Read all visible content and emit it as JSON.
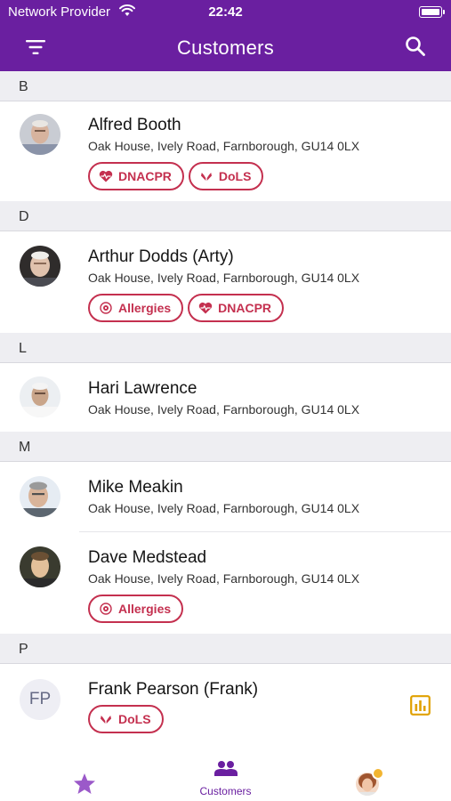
{
  "status_bar": {
    "carrier": "Network Provider",
    "time": "22:42"
  },
  "header": {
    "title": "Customers",
    "filter_icon": "filter-icon",
    "search_icon": "search-icon"
  },
  "sections": [
    {
      "letter": "B",
      "customers": [
        {
          "name": "Alfred Booth",
          "address": "Oak House, Ively Road, Farnborough, GU14 0LX",
          "tags": [
            "DNACPR",
            "DoLS"
          ]
        }
      ]
    },
    {
      "letter": "D",
      "customers": [
        {
          "name": "Arthur Dodds (Arty)",
          "address": "Oak House, Ively Road, Farnborough, GU14 0LX",
          "tags": [
            "Allergies",
            "DNACPR"
          ]
        }
      ]
    },
    {
      "letter": "L",
      "customers": [
        {
          "name": "Hari Lawrence",
          "address": "Oak House, Ively Road, Farnborough, GU14 0LX",
          "tags": []
        }
      ]
    },
    {
      "letter": "M",
      "customers": [
        {
          "name": "Mike Meakin",
          "address": "Oak House, Ively Road, Farnborough, GU14 0LX",
          "tags": []
        },
        {
          "name": "Dave Medstead",
          "address": "Oak House, Ively Road, Farnborough, GU14 0LX",
          "tags": [
            "Allergies"
          ]
        }
      ]
    },
    {
      "letter": "P",
      "customers": [
        {
          "name": "Frank Pearson (Frank)",
          "initials": "FP",
          "address": "",
          "tags": [
            "DoLS"
          ]
        }
      ]
    }
  ],
  "tab_bar": {
    "favourites_icon": "star-icon",
    "customers_label": "Customers",
    "customers_icon": "people-icon",
    "profile_icon": "profile-avatar"
  },
  "colors": {
    "brand": "#6a1fa0",
    "tag": "#c4304f",
    "report_icon": "#e0a100",
    "section_bg": "#eeeef2"
  }
}
